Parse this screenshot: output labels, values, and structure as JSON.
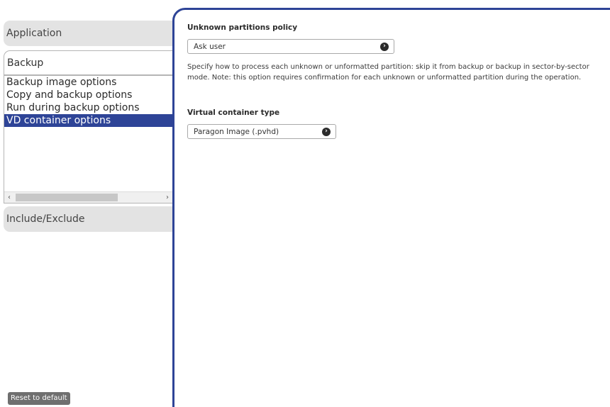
{
  "sidebar": {
    "application_label": "Application",
    "backup_label": "Backup",
    "backup_subitems": [
      "Backup image options",
      "Copy and backup options",
      "Run during backup options",
      "VD container options"
    ],
    "include_exclude_label": "Include/Exclude",
    "scroll_left_icon": "‹",
    "scroll_right_icon": "›",
    "reset_label": "Reset to default"
  },
  "main": {
    "unknown_partitions": {
      "title": "Unknown partitions policy",
      "value": "Ask user",
      "description": "Specify how to process each unknown or unformatted partition: skip it from backup or backup in sector-by-sector mode. Note: this option requires confirmation for each unknown or unformatted partition during the operation."
    },
    "virtual_container": {
      "title": "Virtual container type",
      "value": "Paragon Image (.pvhd)"
    },
    "dropdown_icon": "›"
  },
  "colors": {
    "accent": "#2e4497",
    "tab_bg": "#e3e3e3",
    "reset_bg": "#6f6f6f"
  }
}
